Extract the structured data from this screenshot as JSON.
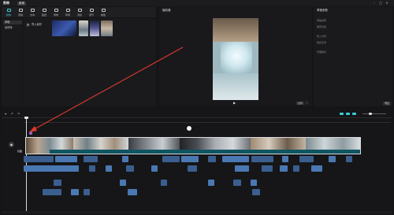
{
  "titlebar": {
    "logo": "剪映",
    "menu_label": "菜单",
    "project_name": "",
    "minimize": "–",
    "maximize": "▢",
    "close": "✕"
  },
  "toolbar": {
    "items": [
      {
        "label": "媒体",
        "icon": "media-icon",
        "active": true
      },
      {
        "label": "音频",
        "icon": "audio-icon"
      },
      {
        "label": "文本",
        "icon": "text-icon"
      },
      {
        "label": "贴纸",
        "icon": "sticker-icon"
      },
      {
        "label": "特效",
        "icon": "effects-icon"
      },
      {
        "label": "转场",
        "icon": "transition-icon"
      },
      {
        "label": "滤镜",
        "icon": "filter-icon"
      },
      {
        "label": "调节",
        "icon": "adjust-icon"
      },
      {
        "label": "模板",
        "icon": "template-icon"
      }
    ]
  },
  "sidebar": {
    "items": [
      {
        "label": "本地",
        "active": true
      },
      {
        "label": "素材库"
      }
    ]
  },
  "media_bin": {
    "import_label": "导入素材",
    "import_sub": "",
    "accent": "#38d0d8"
  },
  "player": {
    "title": "播放器",
    "current_time": "",
    "total_time": "",
    "ratio_label": "比例"
  },
  "details": {
    "title": "草稿参数",
    "rows": [
      {
        "key": "草稿名称",
        "value": ""
      },
      {
        "key": "保存位置",
        "value": ""
      },
      {
        "key": "导入方式",
        "value": ""
      },
      {
        "key": "色彩空间",
        "value": ""
      },
      {
        "key": "代理模式",
        "value": ""
      }
    ],
    "export_label": "导出"
  },
  "timeline": {
    "tooltip": "",
    "cover_label": "封面",
    "marker_label": "",
    "colors": {
      "main_track": "#2b3b45",
      "audio_clip": "#3a5f8f",
      "audio_clip_light": "#4a78b2",
      "playhead": "#d8d8db"
    }
  },
  "annotation": {
    "arrow_color": "#e0392b"
  }
}
